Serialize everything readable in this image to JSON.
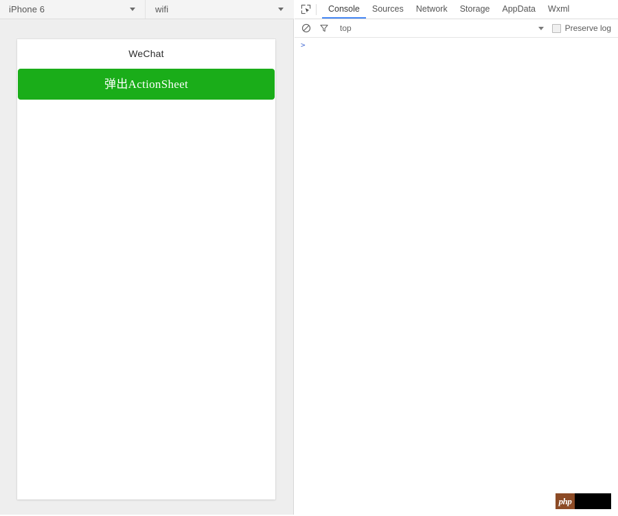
{
  "simulator": {
    "toolbar": {
      "device_selector": {
        "value": "iPhone 6",
        "caret_icon": "chevron-down-icon"
      },
      "network_selector": {
        "value": "wifi",
        "caret_icon": "chevron-down-icon"
      }
    },
    "phone": {
      "title": "WeChat",
      "action_button_label": "弹出ActionSheet",
      "action_button_color": "#1aad19"
    }
  },
  "devtools": {
    "inspect_icon": "inspect-element-icon",
    "tabs": [
      {
        "label": "Console",
        "active": true
      },
      {
        "label": "Sources",
        "active": false
      },
      {
        "label": "Network",
        "active": false
      },
      {
        "label": "Storage",
        "active": false
      },
      {
        "label": "AppData",
        "active": false
      },
      {
        "label": "Wxml",
        "active": false
      }
    ],
    "active_tab_underline_color": "#4285f4",
    "filterbar": {
      "clear_icon": "clear-console-icon",
      "filter_icon": "filter-funnel-icon",
      "context_value": "top",
      "context_caret_icon": "chevron-down-icon",
      "preserve_log_label": "Preserve log",
      "preserve_log_checked": false
    },
    "console": {
      "prompt_symbol": ">",
      "prompt_color": "#4a6fd4",
      "messages": []
    }
  },
  "watermark": {
    "brand_text": "php"
  }
}
